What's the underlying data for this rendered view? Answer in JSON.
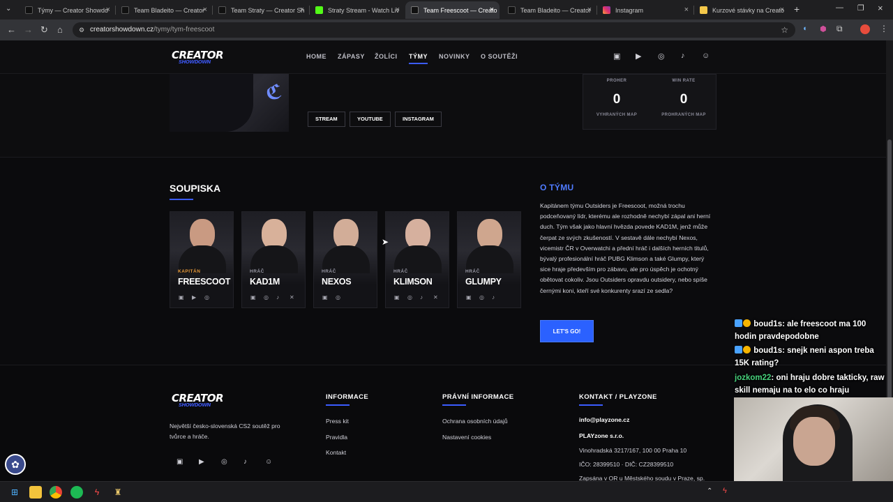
{
  "browser": {
    "tabs": [
      {
        "title": "Týmy — Creator Showdo",
        "favicon_color": "#111111"
      },
      {
        "title": "Team Bladeito — Creator",
        "favicon_color": "#111111"
      },
      {
        "title": "Team Straty — Creator Sh",
        "favicon_color": "#111111"
      },
      {
        "title": "Straty Stream - Watch Liv",
        "favicon_color": "#53fc18"
      },
      {
        "title": "Team Freescoot — Creato",
        "favicon_color": "#111111"
      },
      {
        "title": "Team Bladeito — Creator",
        "favicon_color": "#111111"
      },
      {
        "title": "Instagram",
        "favicon_color": "#e1306c"
      },
      {
        "title": "Kurzové stávky na Creato",
        "favicon_color": "#f4c84a"
      }
    ],
    "url_host": "creatorshowdown.cz",
    "url_path": "/tymy/tym-freescoot"
  },
  "site": {
    "logo_text": "CREATOR",
    "logo_sub": "SHOWDOWN",
    "nav": [
      "HOME",
      "ZÁPASY",
      "ŽOLÍCI",
      "TÝMY",
      "NOVINKY",
      "O SOUTĚŽI"
    ],
    "nav_active": "TÝMY",
    "social_icons": [
      "twitch-icon",
      "youtube-icon",
      "instagram-icon",
      "tiktok-icon",
      "discord-icon"
    ],
    "hero_buttons": [
      "STREAM",
      "YOUTUBE",
      "INSTAGRAM"
    ],
    "stats": {
      "col1_head": "PROHER",
      "col2_head": "WIN RATE",
      "col1_value": "0",
      "col2_value": "0",
      "col1_label": "VYHRANÝCH MAP",
      "col2_label": "PROHRANÝCH MAP"
    },
    "roster_title": "SOUPISKA",
    "players": [
      {
        "role": "KAPITÁN",
        "name": "FREESCOOT",
        "icons": [
          "twitch-icon",
          "youtube-icon",
          "instagram-icon"
        ]
      },
      {
        "role": "HRÁČ",
        "name": "KAD1M",
        "icons": [
          "twitch-icon",
          "instagram-icon",
          "tiktok-icon",
          "x-icon"
        ]
      },
      {
        "role": "HRÁČ",
        "name": "NEXOS",
        "icons": [
          "twitch-icon",
          "instagram-icon"
        ]
      },
      {
        "role": "HRÁČ",
        "name": "KLIMSON",
        "icons": [
          "twitch-icon",
          "instagram-icon",
          "tiktok-icon",
          "x-icon"
        ]
      },
      {
        "role": "HRÁČ",
        "name": "GLUMPY",
        "icons": [
          "twitch-icon",
          "instagram-icon",
          "tiktok-icon"
        ]
      }
    ],
    "about_title": "O TÝMU",
    "about_text": "Kapitánem týmu Outsiders je Freescoot, možná trochu podceňovaný lídr, kterému ale rozhodně nechybí zápal ani herní duch. Tým však jako hlavní hvězda povede KAD1M, jenž může čerpat ze svých zkušeností. V sestavě dále nechybí Nexos, vicemistr ČR v Overwatchi a přední hráč i dalších herních titulů, bývalý profesionální hráč PUBG Klimson a také Glumpy, který sice hraje především pro zábavu, ale pro úspěch je ochotný obětovat cokoliv. Jsou Outsiders opravdu outsidery, nebo spíše černými koni, kteří své konkurenty srazí ze sedla?",
    "cta_label": "LET'S GO!",
    "footer": {
      "tagline": "Největší česko-slovenská CS2 soutěž pro tvůrce a hráče.",
      "col_info_title": "INFORMACE",
      "col_info_links": [
        "Press kit",
        "Pravidla",
        "Kontakt"
      ],
      "col_legal_title": "PRÁVNÍ INFORMACE",
      "col_legal_links": [
        "Ochrana osobních údajů",
        "Nastavení cookies"
      ],
      "col_contact_title": "KONTAKT / PLAYZONE",
      "contact_email": "info@playzone.cz",
      "contact_company": "PLAYzone s.r.o.",
      "contact_address": "Vinohradská 3217/167, 100 00 Praha 10",
      "contact_ids": "IČO: 28399510 · DIČ: CZ28399510",
      "contact_register": "Zapsána v OR u Městského soudu v Praze, sp."
    }
  },
  "chat": [
    {
      "user": "boud1s",
      "text": ": ale freescoot ma 100 hodin pravdepodobne",
      "user_color": "#ffffff"
    },
    {
      "user": "boud1s",
      "text": ": snejk neni aspon treba 15K rating?",
      "user_color": "#ffffff"
    },
    {
      "user": "jozkom22",
      "text": ": oni hraju dobre takticky, raw skill nemaju na to elo co hraju",
      "user_color": "#47d27c"
    }
  ],
  "accent_color": "#3b5cff"
}
